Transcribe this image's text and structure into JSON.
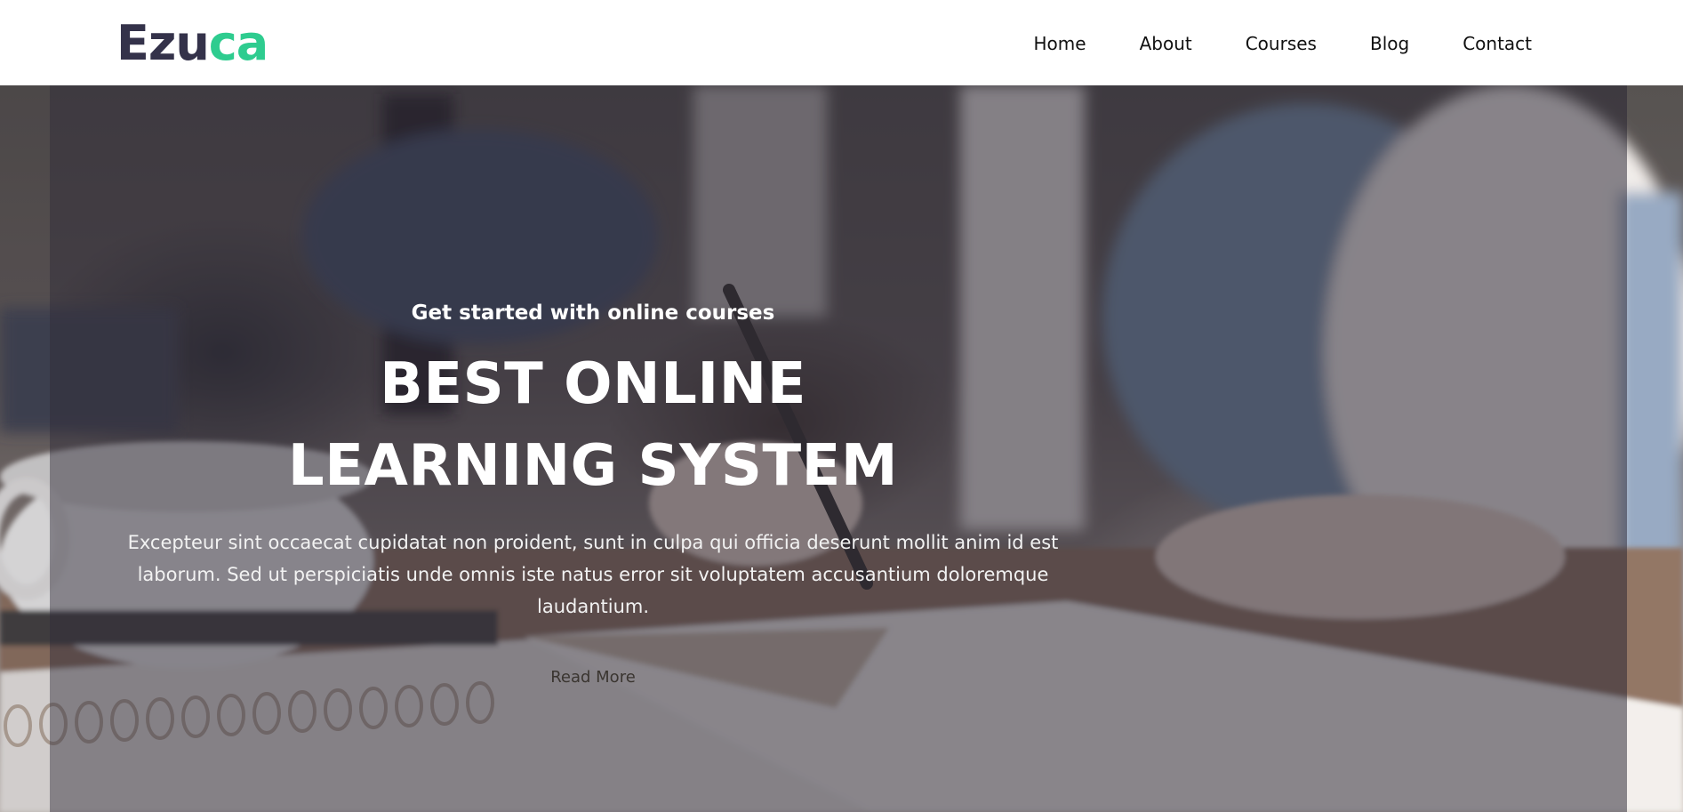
{
  "brand": {
    "logo_part1": "Ezu",
    "logo_part2": "ca",
    "color_dark": "#34324a",
    "color_accent": "#2ecc8f"
  },
  "nav": {
    "items": [
      {
        "label": "Home"
      },
      {
        "label": "About"
      },
      {
        "label": "Courses"
      },
      {
        "label": "Blog"
      },
      {
        "label": "Contact"
      }
    ]
  },
  "hero": {
    "subtitle": "Get started with online courses",
    "title_line1": "BEST ONLINE",
    "title_line2": "LEARNING SYSTEM",
    "description": "Excepteur sint occaecat cupidatat non proident, sunt in culpa qui officia deserunt mollit anim id est laborum. Sed ut perspiciatis unde omnis iste natus error sit voluptatem accusantium doloremque laudantium.",
    "cta_label": "Read More"
  }
}
